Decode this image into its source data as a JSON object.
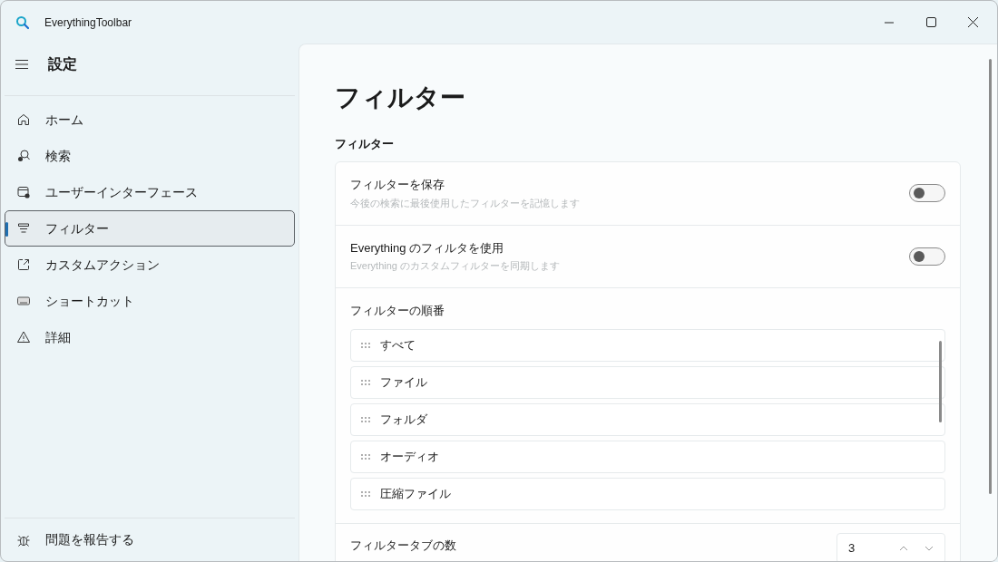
{
  "window": {
    "title": "EverythingToolbar"
  },
  "sidebar": {
    "header": "設定",
    "items": [
      {
        "label": "ホーム",
        "selected": false
      },
      {
        "label": "検索",
        "selected": false
      },
      {
        "label": "ユーザーインターフェース",
        "selected": false
      },
      {
        "label": "フィルター",
        "selected": true
      },
      {
        "label": "カスタムアクション",
        "selected": false
      },
      {
        "label": "ショートカット",
        "selected": false
      },
      {
        "label": "詳細",
        "selected": false
      }
    ],
    "footer_item": {
      "label": "問題を報告する"
    }
  },
  "page": {
    "title": "フィルター",
    "section": "フィルター",
    "settings": [
      {
        "kind": "toggle",
        "label": "フィルターを保存",
        "description": "今後の検索に最後使用したフィルターを記憶します",
        "on": false
      },
      {
        "kind": "toggle",
        "label": "Everything のフィルタを使用",
        "description": "Everything のカスタムフィルターを同期します",
        "on": false
      },
      {
        "kind": "list",
        "label": "フィルターの順番",
        "items": [
          "すべて",
          "ファイル",
          "フォルダ",
          "オーディオ",
          "圧縮ファイル"
        ]
      },
      {
        "kind": "number",
        "label": "フィルタータブの数",
        "value": "3"
      }
    ]
  }
}
